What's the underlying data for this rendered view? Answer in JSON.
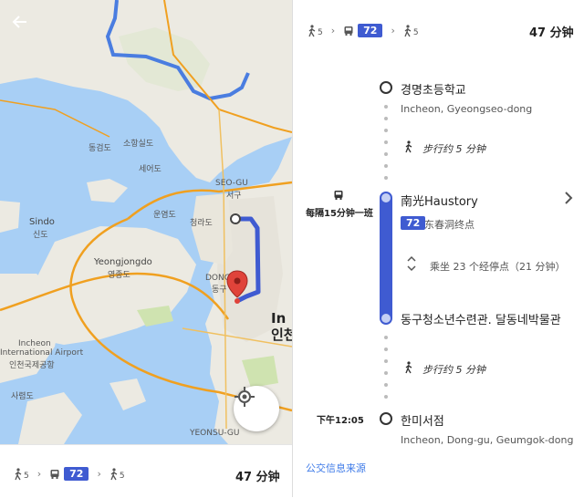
{
  "colors": {
    "bus_blue": "#3f5bd1",
    "route_orange": "#f0a020",
    "water": "#a8cff5",
    "land": "#eceae2",
    "link": "#3f7be8"
  },
  "map": {
    "labels": {
      "donggeomdo": "동검도",
      "sohangsildo": "소항실도",
      "seeodo": "세어도",
      "seogu_en": "SEO-GU",
      "seogu_ko": "서구",
      "unyeomdo": "운염도",
      "cheongrado": "청라도",
      "sindo_en": "Sindo",
      "sindo_ko": "신도",
      "yeongjongdo_en": "Yeongjongdo",
      "yeongjongdo_ko": "영종도",
      "donggu": "DONG-",
      "dong": "동구",
      "incheon_city": "In",
      "incheon_ko": "인천",
      "airport_en1": "Incheon",
      "airport_en2": "International Airport",
      "airport_ko": "인천국제공항",
      "sareumdo": "사렴도",
      "yeonsu": "YEONSU-GU"
    },
    "icons": {
      "back": "arrow-left-icon",
      "locate": "my-location-icon",
      "pin": "map-pin-icon"
    }
  },
  "summary": {
    "walk1": "5",
    "bus": "72",
    "walk2": "5",
    "total": "47 分钟"
  },
  "steps": {
    "start_name": "경명초등학교",
    "start_sub": "Incheon, Gyeongseo-dong",
    "walk1": "步行约 5 分钟",
    "board_name": "南光Haustory",
    "freq": "每隔15分钟一班",
    "route_num": "72",
    "route_dest": "东春洞终点",
    "ride": "乘坐 23 个经停点（21 分钟）",
    "alight_name": "동구청소년수련관. 달동네박물관",
    "walk2": "步行约 5 分钟",
    "arrive_time": "下午12:05",
    "end_name": "한미서점",
    "end_sub": "Incheon, Dong-gu, Geumgok-dong"
  },
  "source_link": "公交信息来源"
}
